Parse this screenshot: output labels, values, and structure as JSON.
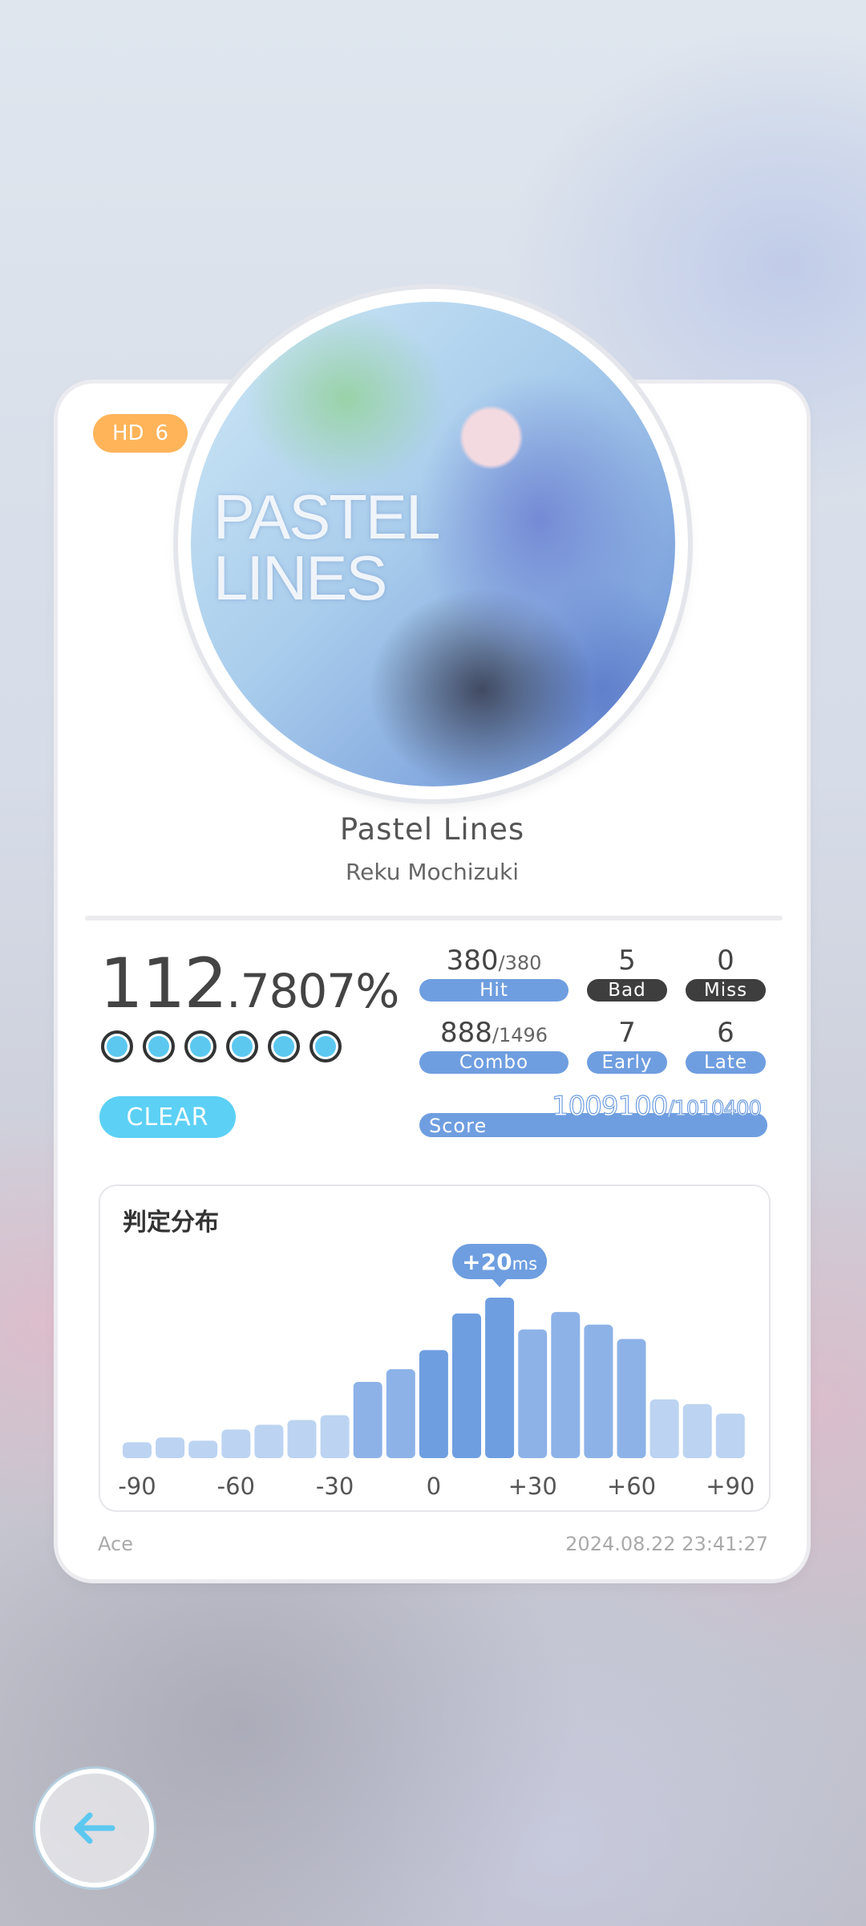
{
  "difficulty": {
    "label": "HD",
    "level": "6",
    "color": "#ffb45a"
  },
  "jacket": {
    "art_text": "PASTEL\nLINES"
  },
  "song": {
    "title": "Pastel Lines",
    "artist": "Reku Mochizuki"
  },
  "accuracy": {
    "integer": "112",
    "decimal": ".7807%"
  },
  "clear_marks": {
    "count": 6,
    "color": "#5cc8f0"
  },
  "clear_status": "CLEAR",
  "stats": {
    "hit": {
      "value": "380",
      "total": "/380",
      "label": "Hit"
    },
    "bad": {
      "value": "5",
      "label": "Bad"
    },
    "miss": {
      "value": "0",
      "label": "Miss"
    },
    "combo": {
      "value": "888",
      "total": "/1496",
      "label": "Combo"
    },
    "early": {
      "value": "7",
      "label": "Early"
    },
    "late": {
      "value": "6",
      "label": "Late"
    }
  },
  "score": {
    "label": "Score",
    "value": "1009100",
    "max": "/1010400"
  },
  "chart_data": {
    "type": "bar",
    "title": "判定分布",
    "x_tick_labels": [
      "-90",
      "-60",
      "-30",
      "0",
      "+30",
      "+60",
      "+90"
    ],
    "x_range": [
      -90,
      90
    ],
    "bin_width_ms": 10,
    "values": [
      10,
      13,
      11,
      18,
      21,
      24,
      27,
      48,
      56,
      68,
      91,
      101,
      81,
      92,
      84,
      75,
      37,
      34,
      28
    ],
    "value_units": "relative",
    "peak_annotation": {
      "value": "+20",
      "unit": "ms"
    },
    "colors": {
      "light": "#bcd3f2",
      "mid": "#8db2e8",
      "dark": "#6e9ee0"
    }
  },
  "footer": {
    "rank": "Ace",
    "timestamp": "2024.08.22 23:41:27"
  },
  "back_button": {
    "icon": "arrow-left-icon",
    "color": "#5cc8f0"
  }
}
